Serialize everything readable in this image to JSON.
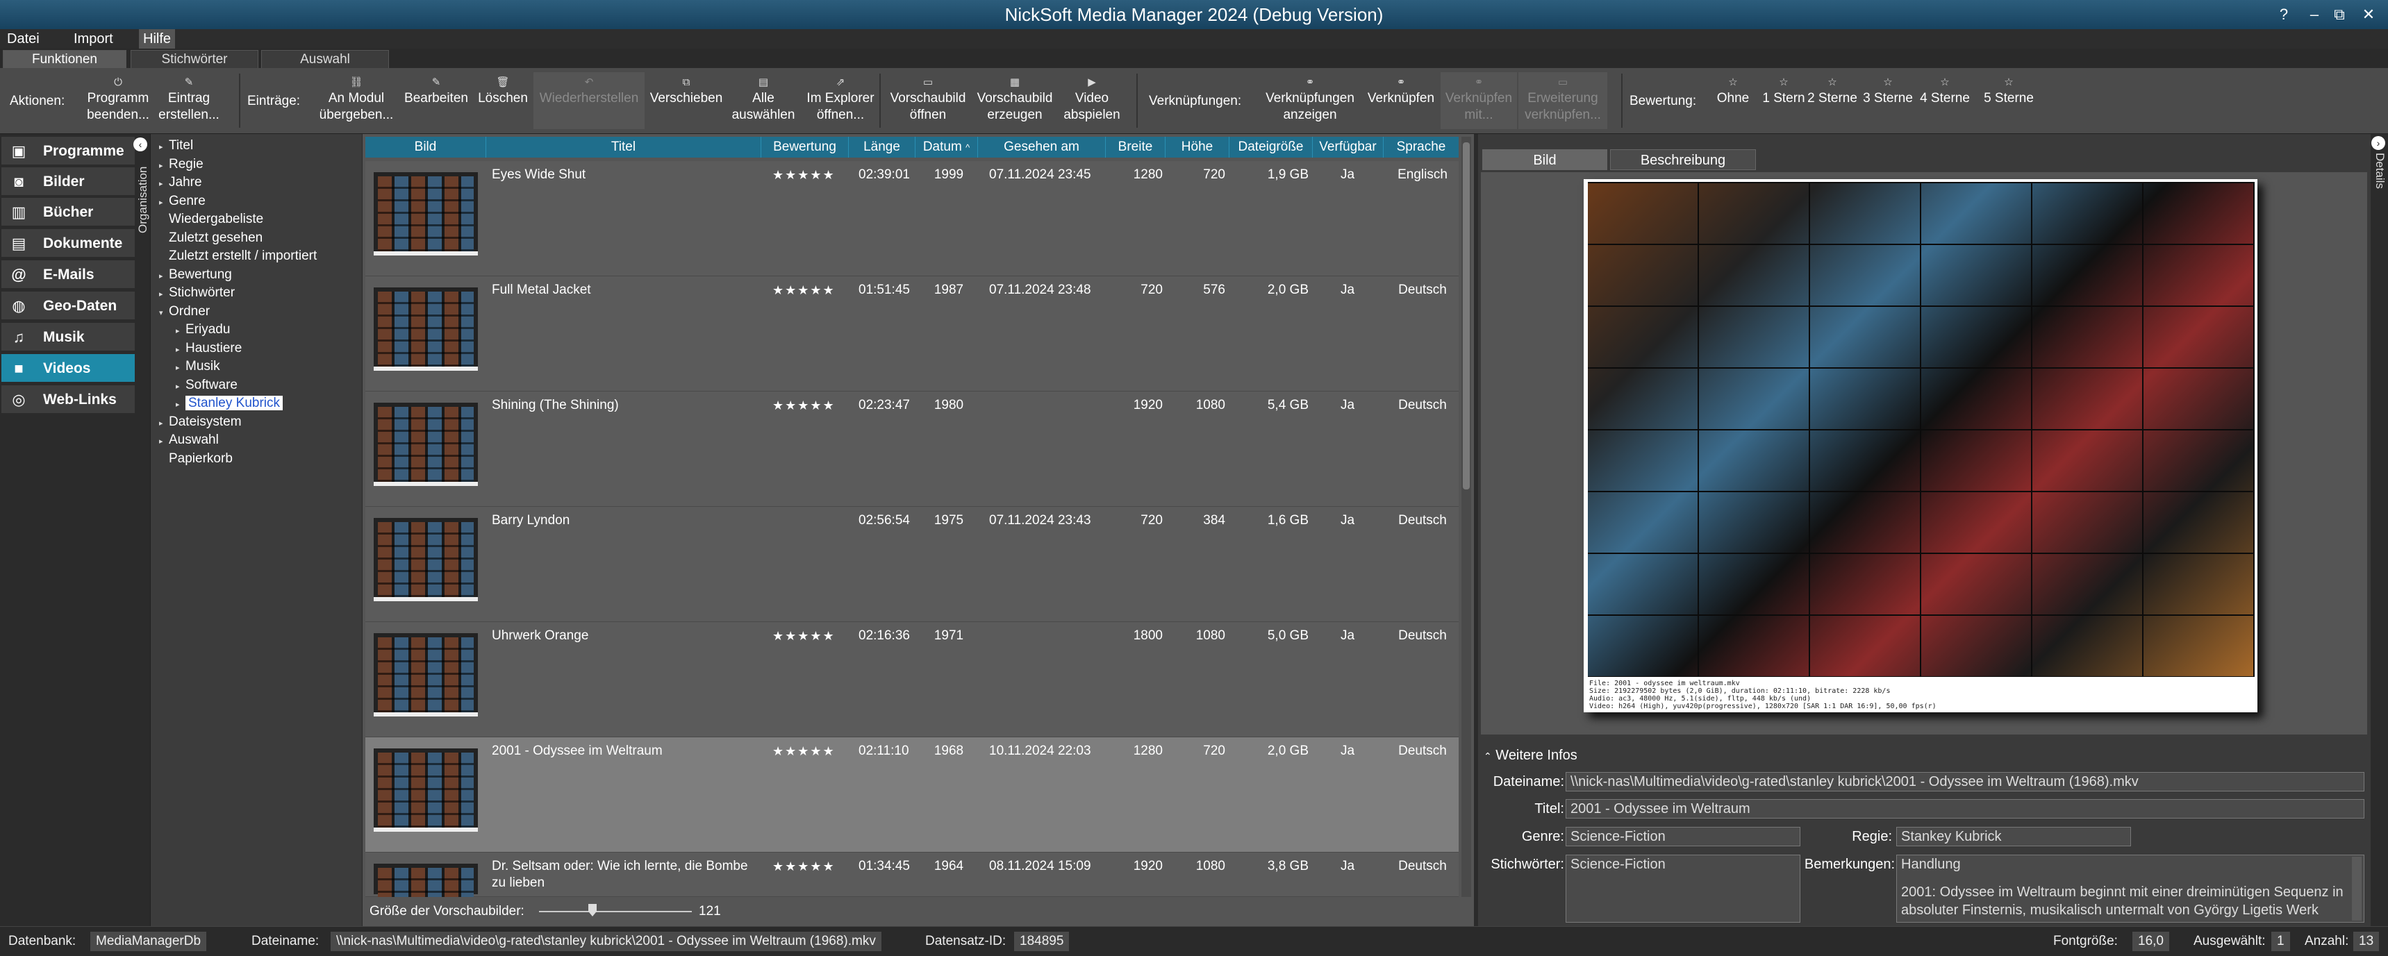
{
  "window": {
    "title": "NickSoft Media Manager 2024 (Debug Version)",
    "controls": [
      "?",
      "–",
      "⧉",
      "✕"
    ]
  },
  "menu": [
    "Datei",
    "Import",
    "Hilfe"
  ],
  "ribbon_tabs": [
    "Funktionen",
    "Stichwörter",
    "Auswahl"
  ],
  "toolbar": {
    "groups": {
      "actions": "Aktionen:",
      "entries": "Einträge:",
      "links": "Verknüpfungen:",
      "rating": "Bewertung:"
    },
    "actions": [
      {
        "l1": "Programm",
        "l2": "beenden..."
      },
      {
        "l1": "Eintrag",
        "l2": "erstellen..."
      }
    ],
    "entries": [
      {
        "l1": "An Modul",
        "l2": "übergeben..."
      },
      {
        "l1": "",
        "l2": "Bearbeiten"
      },
      {
        "l1": "",
        "l2": "Löschen"
      },
      {
        "l1": "",
        "l2": "Wiederherstellen"
      },
      {
        "l1": "",
        "l2": "Verschieben"
      },
      {
        "l1": "Alle",
        "l2": "auswählen"
      },
      {
        "l1": "Im Explorer",
        "l2": "öffnen..."
      },
      {
        "l1": "Vorschaubild",
        "l2": "öffnen"
      },
      {
        "l1": "Vorschaubild",
        "l2": "erzeugen"
      },
      {
        "l1": "Video",
        "l2": "abspielen"
      }
    ],
    "links": [
      {
        "l1": "Verknüpfungen",
        "l2": "anzeigen"
      },
      {
        "l1": "",
        "l2": "Verknüpfen"
      },
      {
        "l1": "Verknüpfen",
        "l2": "mit..."
      },
      {
        "l1": "Erweiterung",
        "l2": "verknüpfen..."
      }
    ],
    "rating": [
      "Ohne",
      "1 Stern",
      "2 Sterne",
      "3 Sterne",
      "4 Sterne",
      "5 Sterne"
    ]
  },
  "nav": [
    "Programme",
    "Bilder",
    "Bücher",
    "Dokumente",
    "E-Mails",
    "Geo-Daten",
    "Musik",
    "Videos",
    "Web-Links"
  ],
  "nav_active": "Videos",
  "org_label": "Organisation",
  "details_label": "Details",
  "tree": [
    {
      "label": "Titel",
      "arrow": "▸",
      "indent": 0
    },
    {
      "label": "Regie",
      "arrow": "▸",
      "indent": 0
    },
    {
      "label": "Jahre",
      "arrow": "▸",
      "indent": 0
    },
    {
      "label": "Genre",
      "arrow": "▸",
      "indent": 0
    },
    {
      "label": "Wiedergabeliste",
      "arrow": "",
      "indent": 0
    },
    {
      "label": "Zuletzt gesehen",
      "arrow": "",
      "indent": 0
    },
    {
      "label": "Zuletzt erstellt / importiert",
      "arrow": "",
      "indent": 0
    },
    {
      "label": "Bewertung",
      "arrow": "▸",
      "indent": 0
    },
    {
      "label": "Stichwörter",
      "arrow": "▸",
      "indent": 0
    },
    {
      "label": "Ordner",
      "arrow": "▾",
      "indent": 0
    },
    {
      "label": "Eriyadu",
      "arrow": "▸",
      "indent": 1
    },
    {
      "label": "Haustiere",
      "arrow": "▸",
      "indent": 1
    },
    {
      "label": "Musik",
      "arrow": "▸",
      "indent": 1
    },
    {
      "label": "Software",
      "arrow": "▸",
      "indent": 1
    },
    {
      "label": "Stanley Kubrick",
      "arrow": "▸",
      "indent": 1,
      "selected": true
    },
    {
      "label": "Dateisystem",
      "arrow": "▸",
      "indent": 0
    },
    {
      "label": "Auswahl",
      "arrow": "▸",
      "indent": 0
    },
    {
      "label": "Papierkorb",
      "arrow": "",
      "indent": 0
    }
  ],
  "columns": [
    "Bild",
    "Titel",
    "Bewertung",
    "Länge",
    "Datum",
    "Gesehen am",
    "Breite",
    "Höhe",
    "Dateigröße",
    "Verfügbar",
    "Sprache"
  ],
  "sort_indicator": "^",
  "rows": [
    {
      "title": "Eyes Wide Shut",
      "rating": "★★★★★",
      "length": "02:39:01",
      "year": "1999",
      "seen": "07.11.2024 23:45",
      "width": "1280",
      "height": "720",
      "size": "1,9 GB",
      "avail": "Ja",
      "lang": "Englisch"
    },
    {
      "title": "Full Metal Jacket",
      "rating": "★★★★★",
      "length": "01:51:45",
      "year": "1987",
      "seen": "07.11.2024 23:48",
      "width": "720",
      "height": "576",
      "size": "2,0 GB",
      "avail": "Ja",
      "lang": "Deutsch"
    },
    {
      "title": "Shining (The Shining)",
      "rating": "★★★★★",
      "length": "02:23:47",
      "year": "1980",
      "seen": "",
      "width": "1920",
      "height": "1080",
      "size": "5,4 GB",
      "avail": "Ja",
      "lang": "Deutsch"
    },
    {
      "title": "Barry Lyndon",
      "rating": "",
      "length": "02:56:54",
      "year": "1975",
      "seen": "07.11.2024 23:43",
      "width": "720",
      "height": "384",
      "size": "1,6 GB",
      "avail": "Ja",
      "lang": "Deutsch"
    },
    {
      "title": "Uhrwerk Orange",
      "rating": "★★★★★",
      "length": "02:16:36",
      "year": "1971",
      "seen": "",
      "width": "1800",
      "height": "1080",
      "size": "5,0 GB",
      "avail": "Ja",
      "lang": "Deutsch"
    },
    {
      "title": "2001 - Odyssee im Weltraum",
      "rating": "★★★★★",
      "length": "02:11:10",
      "year": "1968",
      "seen": "10.11.2024 22:03",
      "width": "1280",
      "height": "720",
      "size": "2,0 GB",
      "avail": "Ja",
      "lang": "Deutsch",
      "selected": true
    },
    {
      "title": "Dr. Seltsam oder: Wie ich lernte, die Bombe zu lieben",
      "rating": "★★★★★",
      "length": "01:34:45",
      "year": "1964",
      "seen": "08.11.2024 15:09",
      "width": "1920",
      "height": "1080",
      "size": "3,8 GB",
      "avail": "Ja",
      "lang": "Deutsch"
    }
  ],
  "thumb_size": {
    "label": "Größe der Vorschaubilder:",
    "value": "121",
    "slider_level": 0.35
  },
  "preview_tabs": [
    "Bild",
    "Beschreibung"
  ],
  "sheet_text": [
    "File: 2001 - odyssee im weltraum.mkv",
    "Size: 2192279502 bytes (2,0 GiB), duration: 02:11:10, bitrate: 2228 kb/s",
    "Audio: ac3, 48000 Hz, 5.1(side), fltp, 448 kb/s (und)",
    "Video: h264 (High), yuv420p(progressive), 1280x720 [SAR 1:1 DAR 16:9], 50,00 fps(r)"
  ],
  "info": {
    "header": "Weitere Infos",
    "file_label": "Dateiname:",
    "file": "\\\\nick-nas\\Multimedia\\video\\g-rated\\stanley kubrick\\2001 - Odyssee im Weltraum (1968).mkv",
    "title_label": "Titel:",
    "title": "2001 - Odyssee im Weltraum",
    "genre_label": "Genre:",
    "genre": "Science-Fiction",
    "director_label": "Regie:",
    "director": "Stankey Kubrick",
    "keywords_label": "Stichwörter:",
    "keywords": "Science-Fiction",
    "remarks_label": "Bemerkungen:",
    "remarks1": "Handlung",
    "remarks2": "2001: Odyssee im Weltraum beginnt mit einer dreiminütigen Sequenz in",
    "remarks3": "absoluter Finsternis, musikalisch untermalt von György Ligetis Werk"
  },
  "status": {
    "db_label": "Datenbank:",
    "db": "MediaManagerDb",
    "file_label": "Dateiname:",
    "file": "\\\\nick-nas\\Multimedia\\video\\g-rated\\stanley kubrick\\2001 - Odyssee im Weltraum (1968).mkv",
    "id_label": "Datensatz-ID:",
    "id": "184895",
    "font_label": "Fontgröße:",
    "font": "16,0",
    "sel_label": "Ausgewählt:",
    "sel": "1",
    "count_label": "Anzahl:",
    "count": "13"
  }
}
